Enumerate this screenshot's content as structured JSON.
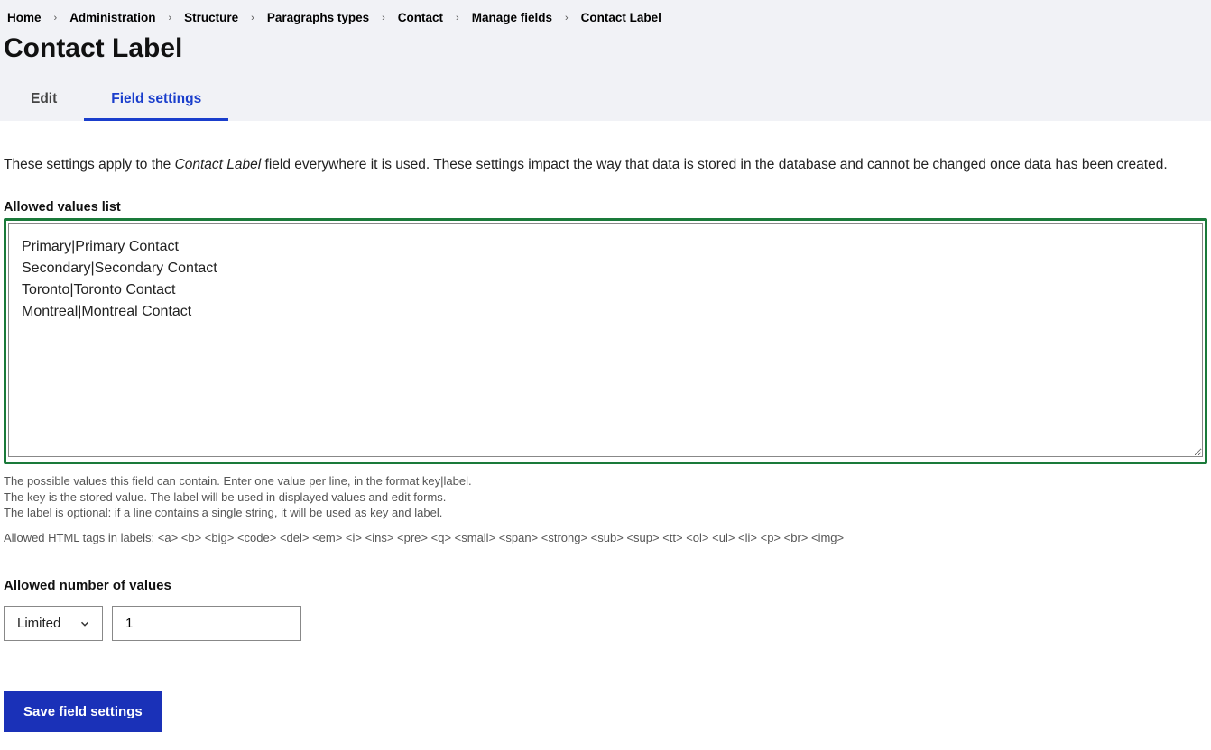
{
  "breadcrumb": {
    "items": [
      {
        "label": "Home"
      },
      {
        "label": "Administration"
      },
      {
        "label": "Structure"
      },
      {
        "label": "Paragraphs types"
      },
      {
        "label": "Contact"
      },
      {
        "label": "Manage fields"
      },
      {
        "label": "Contact Label"
      }
    ]
  },
  "page_title": "Contact Label",
  "tabs": {
    "edit": "Edit",
    "field_settings": "Field settings"
  },
  "intro": {
    "prefix": "These settings apply to the ",
    "field_name": "Contact Label",
    "suffix": " field everywhere it is used. These settings impact the way that data is stored in the database and cannot be changed once data has been created."
  },
  "allowed_values": {
    "label": "Allowed values list",
    "value": "Primary|Primary Contact\nSecondary|Secondary Contact\nToronto|Toronto Contact\nMontreal|Montreal Contact",
    "help1": "The possible values this field can contain. Enter one value per line, in the format key|label.",
    "help2": "The key is the stored value. The label will be used in displayed values and edit forms.",
    "help3": "The label is optional: if a line contains a single string, it will be used as key and label.",
    "help_tags": "Allowed HTML tags in labels: <a> <b> <big> <code> <del> <em> <i> <ins> <pre> <q> <small> <span> <strong> <sub> <sup> <tt> <ol> <ul> <li> <p> <br> <img>"
  },
  "num_values": {
    "label": "Allowed number of values",
    "mode": "Limited",
    "count": "1"
  },
  "buttons": {
    "save": "Save field settings"
  }
}
